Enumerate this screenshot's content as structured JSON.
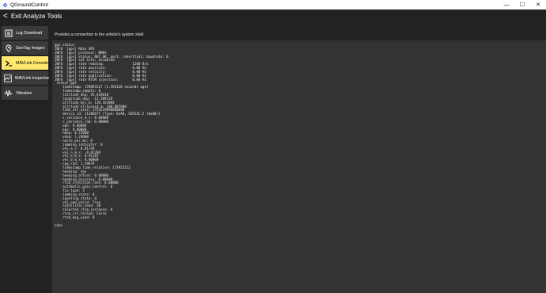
{
  "window": {
    "title": "QGroundControl",
    "controls": [
      "—",
      "☐",
      "✕"
    ]
  },
  "toolbar": {
    "back_chevron": "<",
    "title": "Exit Analyze Tools"
  },
  "sidebar": {
    "items": [
      {
        "label": "Log Download",
        "icon": "document-icon",
        "active": false
      },
      {
        "label": "GeoTag Images",
        "icon": "map-pin-icon",
        "active": false
      },
      {
        "label": "MAVLink Console",
        "icon": "console-icon",
        "active": true
      },
      {
        "label": "MAVLink Inspector",
        "icon": "chart-icon",
        "active": false
      },
      {
        "label": "Vibration",
        "icon": "pulse-icon",
        "active": false
      }
    ]
  },
  "main": {
    "description": "Provides a connection to the vehicle's system shell.",
    "console_lines": [
      "gps status",
      "INFO  [gps] Main GPS",
      "INFO  [gps] protocol: NMEA",
      "INFO  [gps] status: NOT OK, port: /dev/ttyS2, baudrate: 0",
      "INFO  [gps] sat info: disabled",
      "INFO  [gps] rate reading:              1260 B/s",
      "INFO  [gps] rate position:             0.00 Hz",
      "INFO  [gps] rate velocity:             0.00 Hz",
      "INFO  [gps] rate publication:          0.00 Hz",
      "INFO  [gps] rate RTCM injection:       0.00 Hz",
      " sensor_gps",
      "    timestamp: 178093127 (1.592138 seconds ago)",
      "    timestamp_sample: 0",
      "    latitude_deg: 45.810010",
      "    longitude_deg: -12.309128",
      "    altitude_msl_m: 130.163004",
      "    altitude_ellipsoid_m: 100.007000",
      "    time_utc_usec: 1754319090000000",
      "    device_id: 11206677 (Type: 0xAB, SERIAL:2 (0x00))",
      "    s_variance_m_s: 0.00000",
      "    c_variance_rad: 0.00000",
      "    eph: 0.00000",
      "    epv: 0.00000",
      "    hdop: 0.72000",
      "    vdop: 1.24000",
      "    noise_per_ms: 0",
      "    jamming_indicator: 0",
      "    vel_m_s: 0.01749",
      "    vel_n_m_s: -0.01288",
      "    vel_e_m_s: 0.01183",
      "    vel_d_m_s: 0.00000",
      "    cog_rad: 2.39879",
      "    timestamp_time_relative: 177952112",
      "    heading: nan",
      "    heading_offset: 0.00000",
      "    heading_accuracy: 0.00000",
      "    rtcm_injection_rate: 0.00000",
      "    automatic_gain_control: 0",
      "    fix_type: 3",
      "    jamming_state: 0",
      "    spoofing_state: 0",
      "    vel_ned_valid: True",
      "    satellites_used: 30",
      "    selected_rtcm_instance: 0",
      "    rtcm_crc_failed: False",
      "    rtcm_msg_used: 0",
      "",
      "nsh>"
    ]
  },
  "colors": {
    "background": "#222222",
    "sidebar_item": "#3a3a3a",
    "active_item": "#ffe76d",
    "console_bg": "#333333"
  }
}
